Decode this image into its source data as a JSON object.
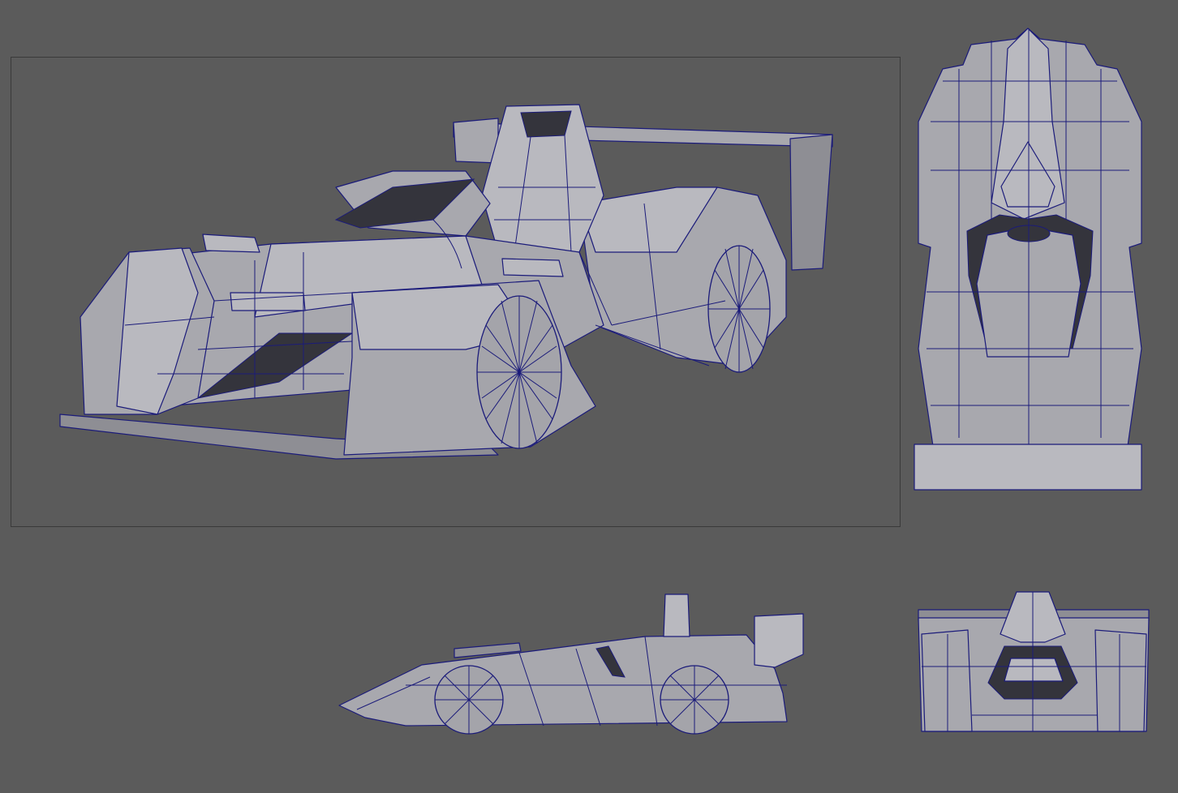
{
  "colors": {
    "background": "#5b5b5b",
    "model_fill": "#a8a8ae",
    "model_fill_light": "#b9b9bf",
    "model_fill_dark": "#8e8e94",
    "wireframe": "#1b1b7a",
    "viewport_border": "#3a3a3a"
  },
  "viewports": [
    {
      "id": "perspective",
      "content": "race-car-3d-wireframe"
    },
    {
      "id": "top",
      "content": "race-car-top-orthographic"
    },
    {
      "id": "side",
      "content": "race-car-side-orthographic"
    },
    {
      "id": "front",
      "content": "race-car-front-orthographic"
    }
  ]
}
